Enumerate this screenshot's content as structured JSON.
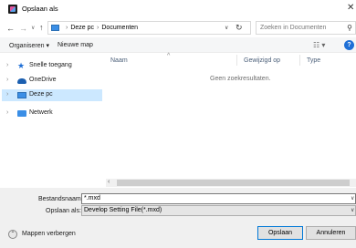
{
  "window": {
    "title": "Opslaan als",
    "close_glyph": "✕"
  },
  "address": {
    "crumbs": [
      "Deze pc",
      "Documenten"
    ],
    "separator": "›",
    "search_placeholder": "Zoeken in Documenten"
  },
  "toolbar": {
    "organize": "Organiseren ▾",
    "new_folder": "Nieuwe map",
    "view_glyph": "☷ ▾",
    "help": "?"
  },
  "nav": {
    "items": [
      {
        "label": "Snelle toegang",
        "icon": "star-icon"
      },
      {
        "label": "OneDrive",
        "icon": "cloud-icon"
      },
      {
        "label": "Deze pc",
        "icon": "computer-icon",
        "selected": true
      },
      {
        "label": "Netwerk",
        "icon": "network-icon"
      }
    ]
  },
  "columns": {
    "name": "Naam",
    "modified": "Gewijzigd op",
    "type": "Type"
  },
  "content": {
    "empty_text": "Geen zoekresultaten."
  },
  "form": {
    "filename_label": "Bestandsnaam:",
    "filename_value": "*.mxd",
    "savetype_label": "Opslaan als:",
    "savetype_value": "Develop Setting File(*.mxd)"
  },
  "footer": {
    "hide_folders": "Mappen verbergen",
    "save": "Opslaan",
    "cancel": "Annuleren"
  }
}
